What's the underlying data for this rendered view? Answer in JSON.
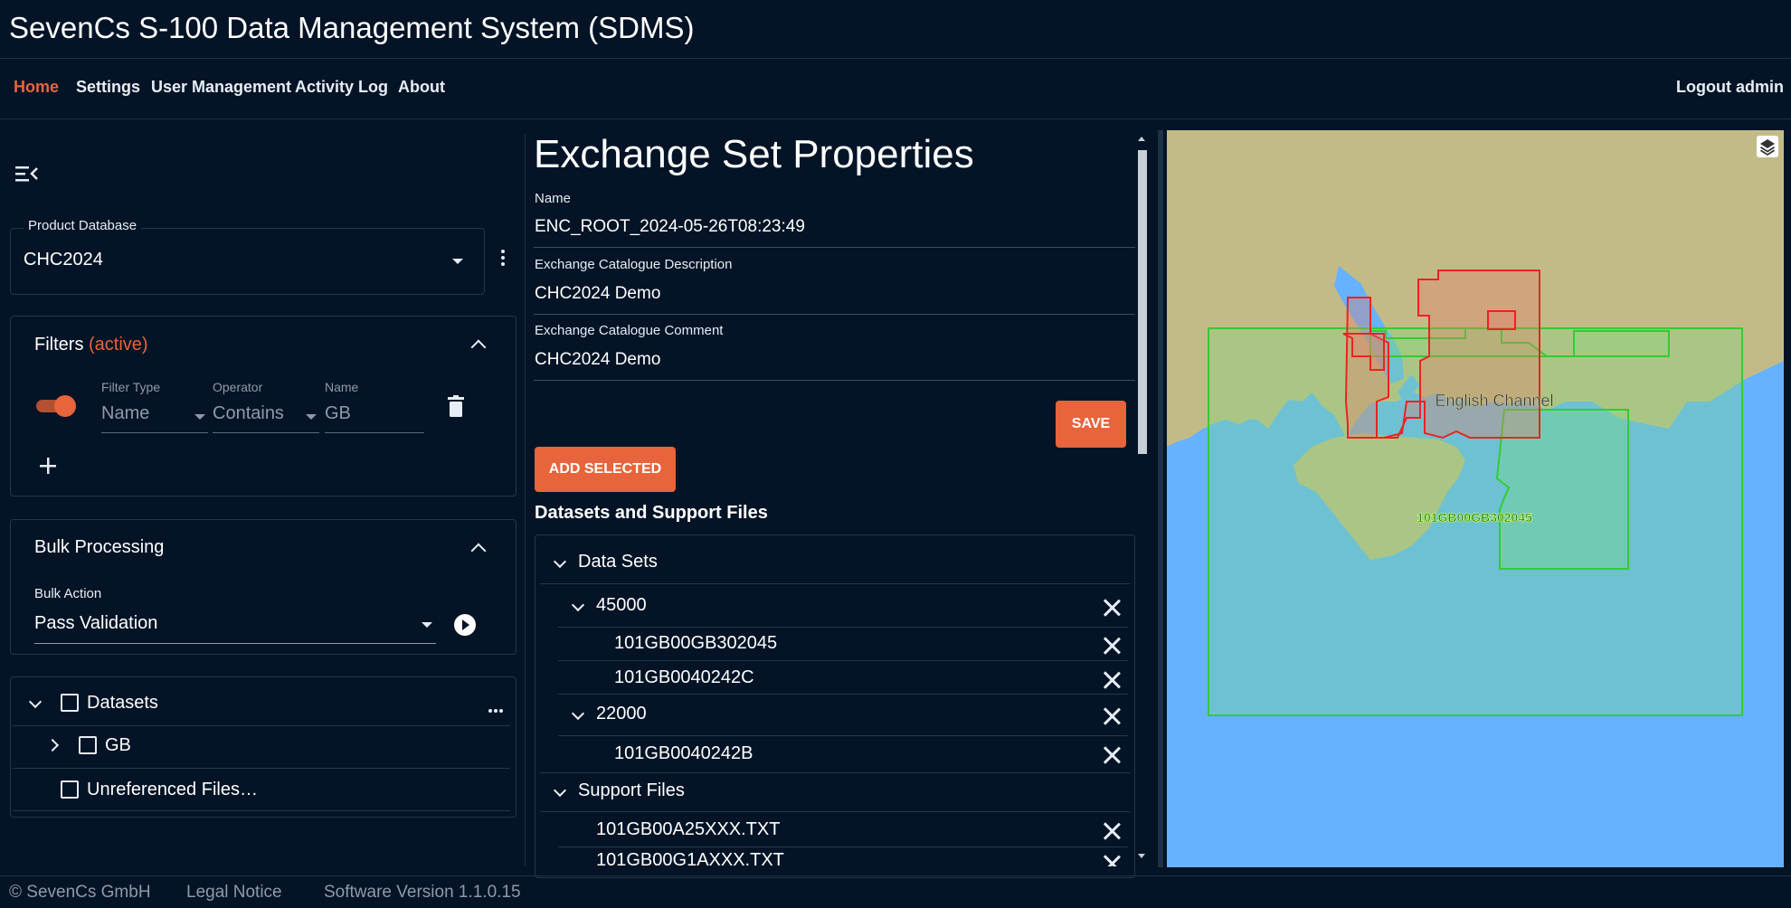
{
  "app_title": "SevenCs S-100 Data Management System (SDMS)",
  "nav": {
    "items": [
      "Home",
      "Settings",
      "User Management",
      "Activity Log",
      "About"
    ],
    "active": "Home",
    "logout": "Logout admin"
  },
  "product_database": {
    "label": "Product Database",
    "value": "CHC2024"
  },
  "filters": {
    "title": "Filters",
    "status": "(active)",
    "filter": {
      "enabled": true,
      "type_label": "Filter Type",
      "type_value": "Name",
      "operator_label": "Operator",
      "operator_value": "Contains",
      "name_label": "Name",
      "name_value": "GB"
    }
  },
  "bulk": {
    "title": "Bulk Processing",
    "action_label": "Bulk Action",
    "action_value": "Pass Validation"
  },
  "dataset_tree": {
    "root": "Datasets",
    "child": "GB",
    "unreferenced": "Unreferenced Files…"
  },
  "exchange_set": {
    "title": "Exchange Set Properties",
    "name_label": "Name",
    "name_value": "ENC_ROOT_2024-05-26T08:23:49",
    "desc_label": "Exchange Catalogue Description",
    "desc_value": "CHC2024 Demo",
    "comment_label": "Exchange Catalogue Comment",
    "comment_value": "CHC2024 Demo",
    "save": "SAVE",
    "add_selected": "ADD SELECTED",
    "list_heading": "Datasets and Support Files",
    "data_sets_label": "Data Sets",
    "group_a": "45000",
    "group_a_items": [
      "101GB00GB302045",
      "101GB0040242C"
    ],
    "group_b": "22000",
    "group_b_items": [
      "101GB0040242B"
    ],
    "support_label": "Support Files",
    "support_items": [
      "101GB00A25XXX.TXT",
      "101GB00G1AXXX.TXT"
    ]
  },
  "map": {
    "place_label": "English Channel",
    "cell_label": "101GB00GB302045",
    "colors": {
      "sea": "#66b2ff",
      "land": "#c3bb87",
      "cell_green": "#33cc33",
      "cell_red": "#ee2222"
    }
  },
  "footer": {
    "copyright": "© SevenCs GmbH",
    "legal": "Legal Notice",
    "version": "Software Version 1.1.0.15"
  }
}
